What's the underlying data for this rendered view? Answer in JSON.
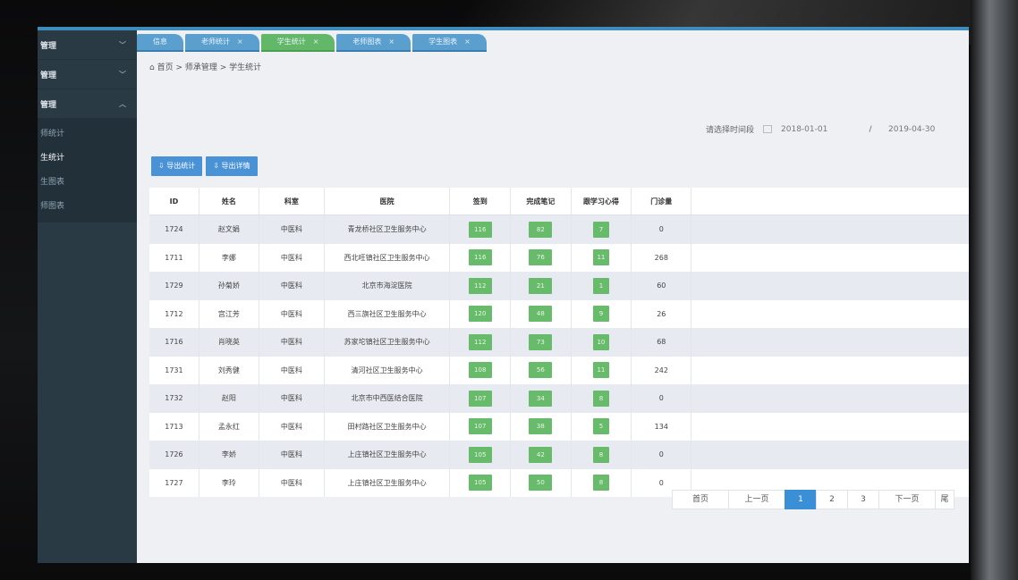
{
  "sidebar": {
    "groups": [
      {
        "label": "管理",
        "chevron": "chevron-down-icon"
      },
      {
        "label": "管理",
        "chevron": "chevron-down-icon"
      },
      {
        "label": "管理",
        "chevron": "chevron-up-icon"
      }
    ],
    "items": [
      {
        "label": "师统计"
      },
      {
        "label": "生统计"
      },
      {
        "label": "生图表"
      },
      {
        "label": "师图表"
      }
    ]
  },
  "tabs": [
    {
      "label": "信息"
    },
    {
      "label": "老师统计",
      "close": "×"
    },
    {
      "label": "学生统计",
      "close": "×"
    },
    {
      "label": "老师图表",
      "close": "×"
    },
    {
      "label": "学生图表",
      "close": "×"
    }
  ],
  "breadcrumb": "首页 > 师承管理 > 学生统计",
  "filter": {
    "label": "请选择时间段",
    "start": "2018-01-01",
    "sep": "/",
    "end": "2019-04-30"
  },
  "buttons": {
    "export_stats": "导出统计",
    "export_detail": "导出详情"
  },
  "table": {
    "headers": [
      "ID",
      "姓名",
      "科室",
      "医院",
      "签到",
      "完成笔记",
      "跟学习心得",
      "门诊量"
    ],
    "rows": [
      {
        "id": "1724",
        "name": "赵文娟",
        "dept": "中医科",
        "hospital": "青龙桥社区卫生服务中心",
        "checkin": "116",
        "notes": "82",
        "insights": "7",
        "visits": "0"
      },
      {
        "id": "1711",
        "name": "李娜",
        "dept": "中医科",
        "hospital": "西北旺镇社区卫生服务中心",
        "checkin": "116",
        "notes": "76",
        "insights": "11",
        "visits": "268"
      },
      {
        "id": "1729",
        "name": "孙菊娇",
        "dept": "中医科",
        "hospital": "北京市海淀医院",
        "checkin": "112",
        "notes": "21",
        "insights": "1",
        "visits": "60"
      },
      {
        "id": "1712",
        "name": "宫江芳",
        "dept": "中医科",
        "hospital": "西三旗社区卫生服务中心",
        "checkin": "120",
        "notes": "48",
        "insights": "9",
        "visits": "26"
      },
      {
        "id": "1716",
        "name": "肖晓英",
        "dept": "中医科",
        "hospital": "苏家坨镇社区卫生服务中心",
        "checkin": "112",
        "notes": "73",
        "insights": "10",
        "visits": "68"
      },
      {
        "id": "1731",
        "name": "刘秀健",
        "dept": "中医科",
        "hospital": "清河社区卫生服务中心",
        "checkin": "108",
        "notes": "56",
        "insights": "11",
        "visits": "242"
      },
      {
        "id": "1732",
        "name": "赵阳",
        "dept": "中医科",
        "hospital": "北京市中西医结合医院",
        "checkin": "107",
        "notes": "34",
        "insights": "8",
        "visits": "0"
      },
      {
        "id": "1713",
        "name": "孟永红",
        "dept": "中医科",
        "hospital": "田村路社区卫生服务中心",
        "checkin": "107",
        "notes": "38",
        "insights": "5",
        "visits": "134"
      },
      {
        "id": "1726",
        "name": "李娇",
        "dept": "中医科",
        "hospital": "上庄镇社区卫生服务中心",
        "checkin": "105",
        "notes": "42",
        "insights": "8",
        "visits": "0"
      },
      {
        "id": "1727",
        "name": "李玲",
        "dept": "中医科",
        "hospital": "上庄镇社区卫生服务中心",
        "checkin": "105",
        "notes": "50",
        "insights": "8",
        "visits": "0"
      }
    ]
  },
  "pagination": {
    "first": "首页",
    "prev": "上一页",
    "pages": [
      "1",
      "2",
      "3"
    ],
    "current": "1",
    "next": "下一页",
    "last": "尾"
  },
  "colors": {
    "accent": "#3c8dbc",
    "sidebar_bg": "#2a3a45",
    "tab_blue": "#5b9fcf",
    "tab_active_green": "#63b768",
    "pill_green": "#67bb6a",
    "button_blue": "#4a92d6"
  }
}
